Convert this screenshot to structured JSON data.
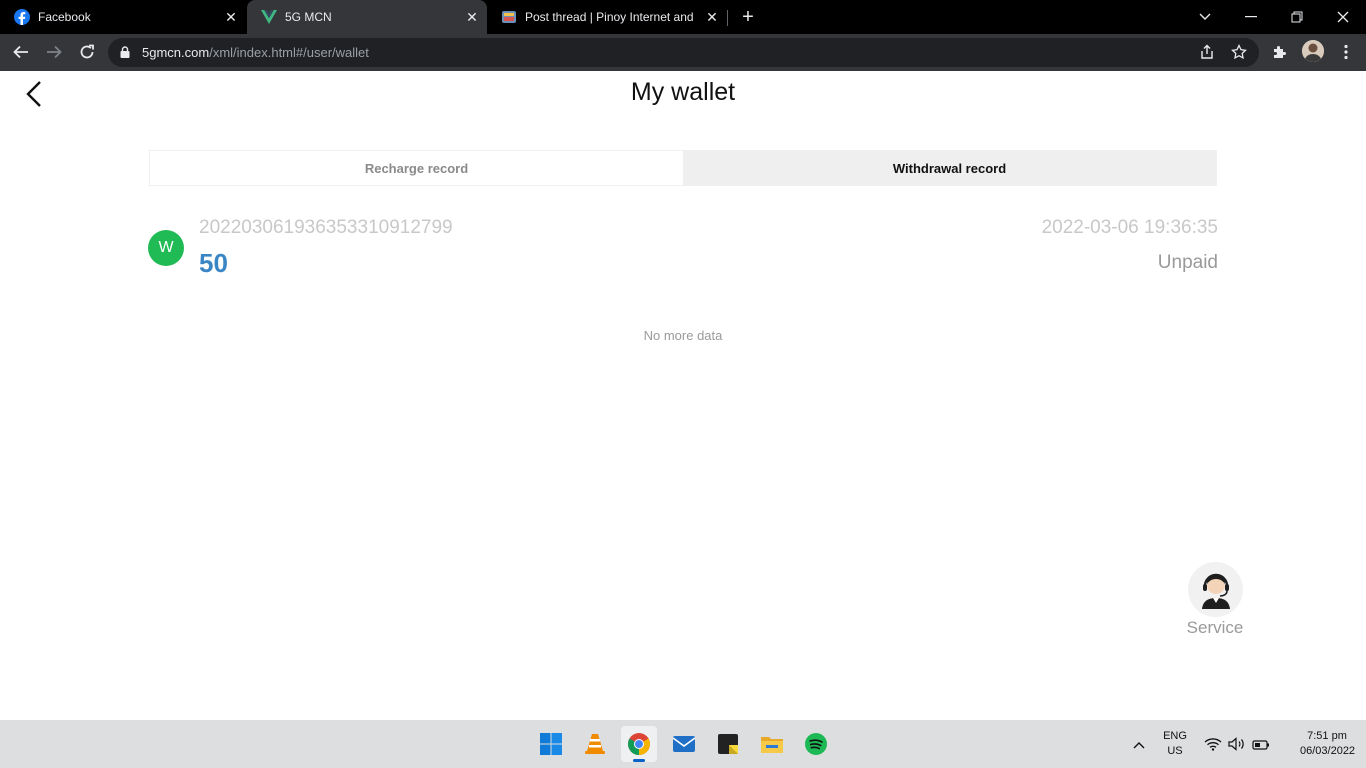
{
  "browser": {
    "tabs": [
      {
        "title": "Facebook",
        "icon": "facebook-icon",
        "active": false
      },
      {
        "title": "5G MCN",
        "icon": "vue-icon",
        "active": true
      },
      {
        "title": "Post thread | Pinoy Internet and T",
        "icon": "forum-icon",
        "active": false
      }
    ],
    "url_host": "5gmcn.com",
    "url_path": "/xml/index.html#/user/wallet"
  },
  "page": {
    "title": "My wallet",
    "tabs": [
      {
        "label": "Recharge record",
        "selected": false
      },
      {
        "label": "Withdrawal record",
        "selected": true
      }
    ],
    "records": [
      {
        "avatar_letter": "W",
        "order_id": "202203061936353310912799",
        "amount": "50",
        "time": "2022-03-06 19:36:35",
        "status": "Unpaid"
      }
    ],
    "no_more": "No more data",
    "service_label": "Service"
  },
  "taskbar": {
    "lang": "ENG",
    "region": "US",
    "time": "7:51 pm",
    "date": "06/03/2022"
  },
  "colors": {
    "amount": "#3a86c5",
    "avatar_bg": "#20bb54",
    "chrome_bg": "#35363a"
  }
}
